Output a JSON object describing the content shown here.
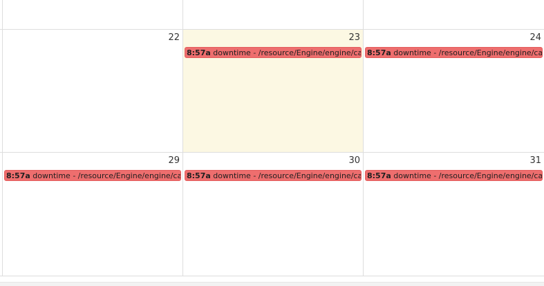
{
  "weeks": [
    {
      "days": [
        {
          "number": "",
          "today": false,
          "events": []
        },
        {
          "number": "",
          "today": false,
          "events": []
        },
        {
          "number": "",
          "today": false,
          "events": []
        }
      ]
    },
    {
      "days": [
        {
          "number": "22",
          "today": false,
          "events": []
        },
        {
          "number": "23",
          "today": true,
          "events": [
            {
              "time": "8:57a",
              "title": "downtime - /resource/Engine/engine/capens"
            }
          ]
        },
        {
          "number": "24",
          "today": false,
          "events": [
            {
              "time": "8:57a",
              "title": "downtime - /resource/Engine/engine/capens"
            }
          ]
        }
      ]
    },
    {
      "days": [
        {
          "number": "29",
          "today": false,
          "events": [
            {
              "time": "8:57a",
              "title": "downtime - /resource/Engine/engine/capens"
            }
          ]
        },
        {
          "number": "30",
          "today": false,
          "events": [
            {
              "time": "8:57a",
              "title": "downtime - /resource/Engine/engine/capens"
            }
          ]
        },
        {
          "number": "31",
          "today": false,
          "events": [
            {
              "time": "8:57a",
              "title": "downtime - /resource/Engine/engine/capens"
            }
          ]
        }
      ]
    }
  ],
  "colors": {
    "today_background": "#fcf8e3",
    "event_background": "#ee6e6e",
    "grid_line": "#dddddd"
  }
}
